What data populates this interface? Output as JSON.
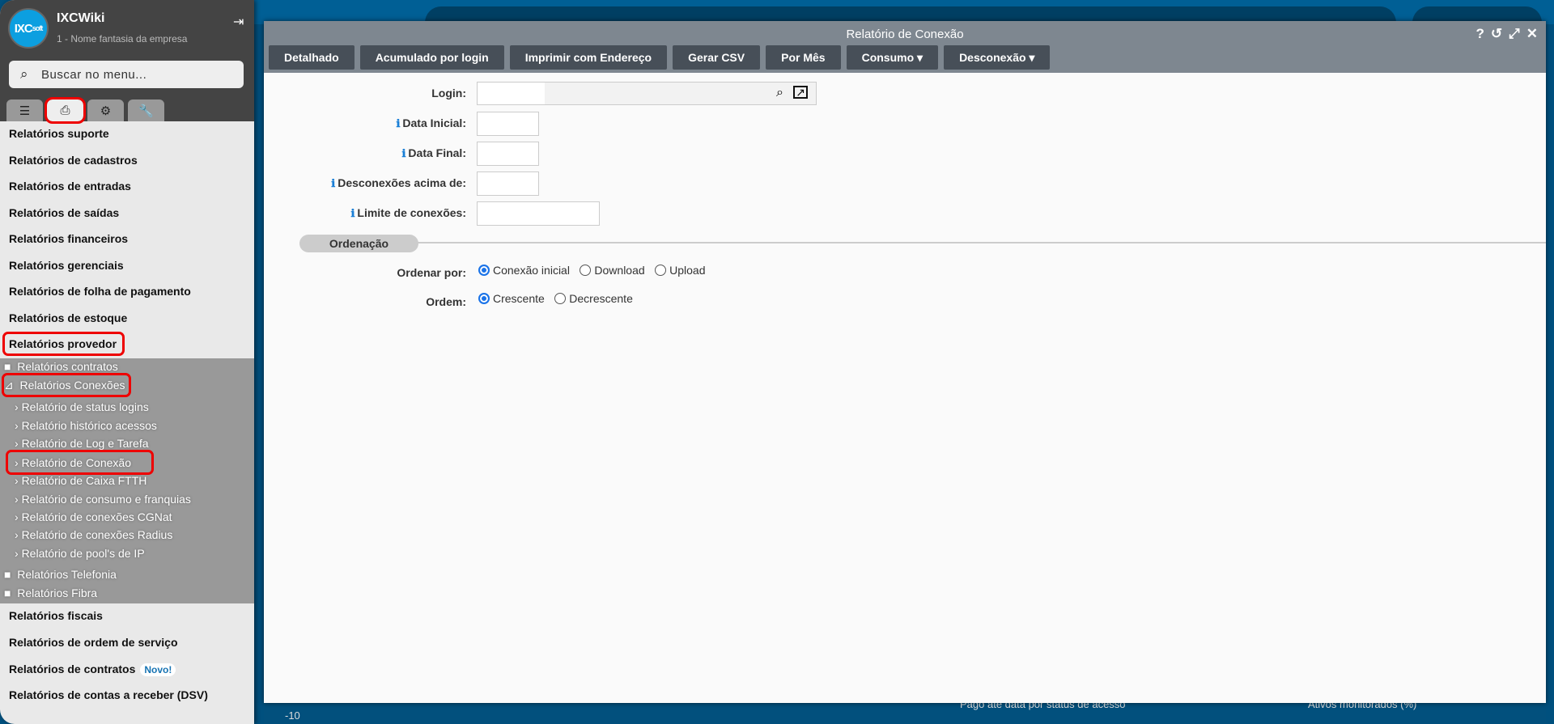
{
  "sidebar": {
    "app_name": "IXCWiki",
    "company": "1 - Nome fantasia da empresa",
    "logo": "IXCsoft",
    "search_placeholder": "Buscar no menu...",
    "tabs": [
      "list-icon",
      "print-icon",
      "gears-icon",
      "wrench-icon"
    ],
    "items": [
      "Relatórios suporte",
      "Relatórios de cadastros",
      "Relatórios de entradas",
      "Relatórios de saídas",
      "Relatórios financeiros",
      "Relatórios gerenciais",
      "Relatórios de folha de pagamento",
      "Relatórios de estoque",
      "Relatórios provedor"
    ],
    "folders": {
      "contratos": "Relatórios contratos",
      "conexoes": "Relatórios Conexões",
      "telefonia": "Relatórios Telefonia",
      "fibra": "Relatórios Fibra"
    },
    "sub_items": [
      "Relatório de status logins",
      "Relatório histórico acessos",
      "Relatório de Log e Tarefa",
      "Relatório de Conexão",
      "Relatório de Caixa FTTH",
      "Relatório de consumo e franquias",
      "Relatório de conexões CGNat",
      "Relatório de conexões Radius",
      "Relatório de pool's de IP"
    ],
    "bottom_items": [
      "Relatórios fiscais",
      "Relatórios de ordem de serviço",
      "Relatórios de contratos",
      "Relatórios de contas a receber (DSV)"
    ],
    "badge": "Novo!"
  },
  "background": {
    "axis_label": "-10",
    "panel1": "Pago até data por status de acesso",
    "panel2": "Ativos monitorados (%)"
  },
  "modal": {
    "title": "Relatório de Conexão",
    "buttons": [
      "Detalhado",
      "Acumulado por login",
      "Imprimir com Endereço",
      "Gerar CSV",
      "Por Mês",
      "Consumo ▾",
      "Desconexão ▾"
    ],
    "fields": {
      "login": "Login:",
      "data_inicial": "Data Inicial:",
      "data_final": "Data Final:",
      "desconexoes": "Desconexões acima de:",
      "limite": "Limite de conexões:"
    },
    "section": "Ordenação",
    "ordenar_label": "Ordenar por:",
    "ordenar_options": [
      "Conexão inicial",
      "Download",
      "Upload"
    ],
    "ordenar_selected": "Conexão inicial",
    "ordem_label": "Ordem:",
    "ordem_options": [
      "Crescente",
      "Decrescente"
    ],
    "ordem_selected": "Crescente"
  }
}
